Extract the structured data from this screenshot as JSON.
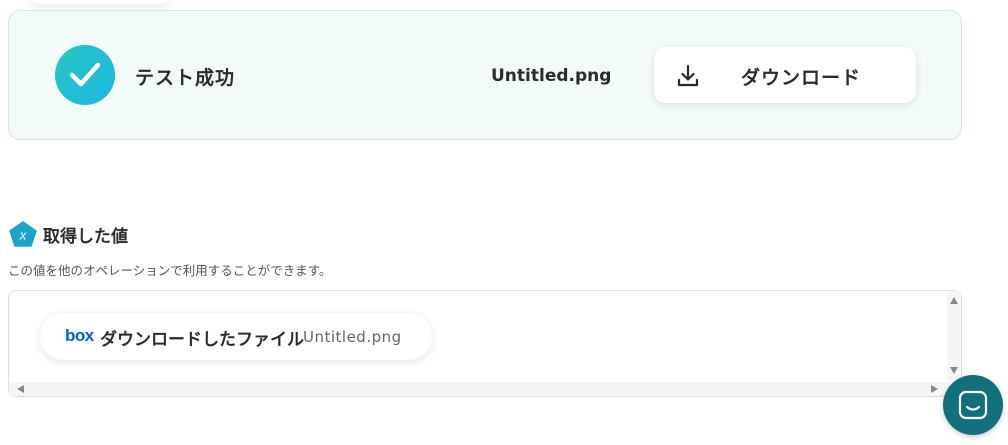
{
  "status_panel": {
    "status_text": "テスト成功",
    "file_name": "Untitled.png",
    "download_label": "ダウンロード",
    "accent_gradient": [
      "#25c7c0",
      "#1eb6e4"
    ],
    "background_color": "#f2fafa"
  },
  "retrieved_values": {
    "title": "取得した値",
    "description": "この値を他のオペレーションで利用することができます。",
    "items": [
      {
        "source_logo": "box",
        "label": "ダウンロードしたファイル",
        "value": "Untitled.png"
      }
    ]
  },
  "icons": {
    "success": "check-icon",
    "download": "download-icon",
    "section": "variable-icon",
    "chat": "chat-icon"
  },
  "colors": {
    "box_brand": "#0061d5",
    "chat_button": "#126f7e"
  }
}
